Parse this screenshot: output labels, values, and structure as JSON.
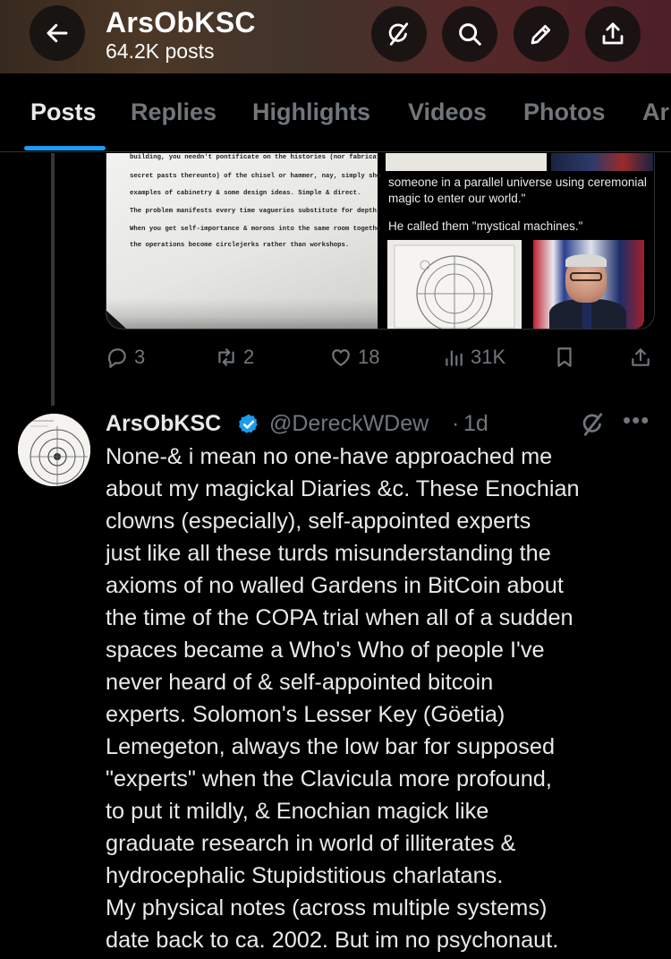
{
  "header": {
    "name": "ArsObKSC",
    "post_count": "64.2K posts"
  },
  "tabs": [
    {
      "label": "Posts",
      "active": true
    },
    {
      "label": "Replies",
      "active": false
    },
    {
      "label": "Highlights",
      "active": false
    },
    {
      "label": "Videos",
      "active": false
    },
    {
      "label": "Photos",
      "active": false
    },
    {
      "label": "Ar",
      "active": false
    }
  ],
  "prev_tweet": {
    "typed_page_lines": [
      "building, you needn't pontificate on the histories (nor fabricate",
      "secret pasts thereunto) of the chisel or hammer, nay, simply show",
      "examples of cabinetry & some design ideas.  Simple & direct.",
      "The problem manifests every time vagueries substitute for depth.",
      "When you get self-importance & morons into the same room together,",
      "the operations become circlejerks rather than workshops."
    ],
    "quote_text_1": "someone in a parallel universe using ceremonial magic to enter our world.\"",
    "quote_text_2": "He called them \"mystical machines.\"",
    "actions": {
      "replies": "3",
      "reposts": "2",
      "likes": "18",
      "views": "31K"
    }
  },
  "tweet": {
    "name": "ArsObKSC",
    "handle": "@DereckWDew",
    "separator": "·",
    "time": "1d",
    "more": "•••",
    "lines": [
      "None-& i mean no one-have approached me",
      "about my magickal Diaries &c. These Enochian",
      "clowns (especially), self-appointed experts",
      "just like all these turds misunderstanding the",
      "axioms of no walled Gardens in BitCoin about",
      "the time of the COPA trial when all of a sudden",
      "spaces became a Who's Who of people I've",
      "never heard of & self-appointed bitcoin",
      "experts. Solomon's Lesser Key (Göetia)",
      "Lemegeton, always the low bar for supposed",
      "\"experts\" when the Clavicula more profound,",
      "to put it mildly, & Enochian magick like",
      "graduate research in world of illiterates &",
      "hydrocephalic Stupidstitious charlatans.",
      "My physical notes (across multiple systems)",
      "date back to ca. 2002.  But im no psychonaut."
    ]
  },
  "icons": {
    "back": "arrow-left-icon",
    "grok": "grok-icon",
    "search": "search-icon",
    "edit": "pencil-icon",
    "share": "share-icon",
    "reply": "reply-icon",
    "repost": "repost-icon",
    "like": "heart-icon",
    "views": "views-icon",
    "bookmark": "bookmark-icon",
    "verified": "verified-badge-icon"
  },
  "colors": {
    "background": "#000000",
    "text": "#e7e9ea",
    "muted": "#71767b",
    "accent": "#1d9bf0",
    "divider": "#2f3336"
  }
}
